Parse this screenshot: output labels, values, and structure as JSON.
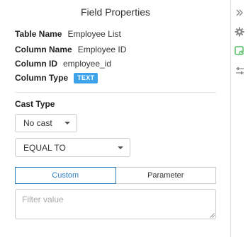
{
  "panel": {
    "title": "Field Properties"
  },
  "properties": {
    "table_name_key": "Table Name",
    "table_name_value": "Employee List",
    "column_name_key": "Column Name",
    "column_name_value": "Employee ID",
    "column_id_key": "Column ID",
    "column_id_value": "employee_id",
    "column_type_key": "Column Type",
    "column_type_value": "TEXT"
  },
  "cast": {
    "label": "Cast Type",
    "selected": "No cast"
  },
  "operator": {
    "selected": "EQUAL TO"
  },
  "mode_tabs": {
    "custom": "Custom",
    "parameter": "Parameter",
    "active": "custom"
  },
  "filter": {
    "placeholder": "Filter value"
  },
  "rail": {
    "icons": [
      "collapse-icon",
      "gear-icon",
      "field-settings-icon",
      "sliders-icon"
    ]
  },
  "colors": {
    "accent": "#2f7fc4",
    "badge": "#3fa3ea",
    "active_icon": "#39b54a"
  }
}
